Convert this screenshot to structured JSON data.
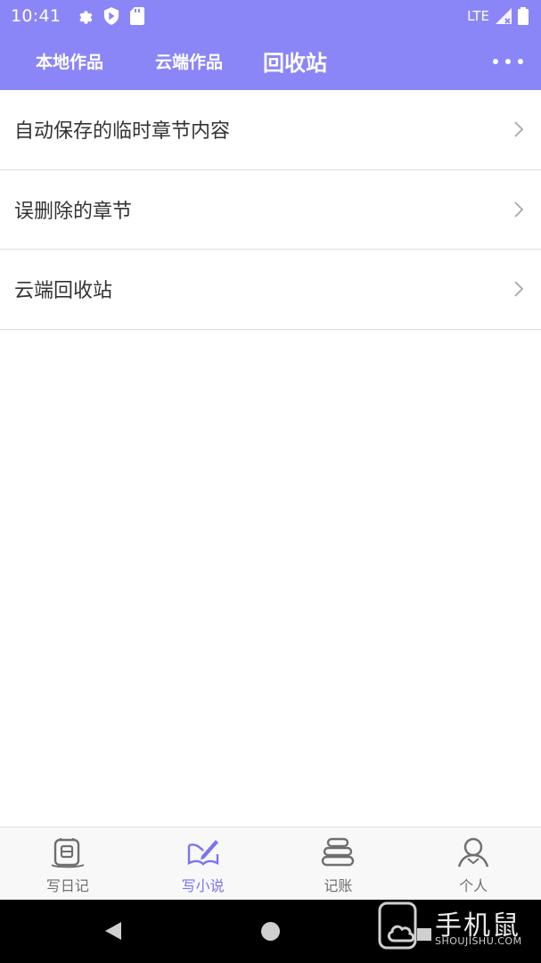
{
  "status_bar": {
    "time": "10:41",
    "network": "LTE",
    "icons": [
      "gear-icon",
      "shield-play-icon",
      "sd-card-icon",
      "signal-icon",
      "battery-icon"
    ]
  },
  "app_bar": {
    "tabs": [
      {
        "label": "本地作品",
        "active": false
      },
      {
        "label": "云端作品",
        "active": false
      },
      {
        "label": "回收站",
        "active": true
      }
    ],
    "menu_icon": "more-dots-icon"
  },
  "list": {
    "items": [
      {
        "label": "自动保存的临时章节内容"
      },
      {
        "label": "误删除的章节"
      },
      {
        "label": "云端回收站"
      }
    ]
  },
  "bottom_nav": {
    "items": [
      {
        "label": "写日记",
        "icon": "diary-icon",
        "active": false
      },
      {
        "label": "写小说",
        "icon": "novel-pen-icon",
        "active": true
      },
      {
        "label": "记账",
        "icon": "coins-stack-icon",
        "active": false
      },
      {
        "label": "个人",
        "icon": "person-icon",
        "active": false
      }
    ]
  },
  "colors": {
    "header": "#8b86f7",
    "accent": "#7b74f0"
  },
  "watermark": {
    "text": "手机鼠",
    "sub": "SHOUJISHU.COM"
  }
}
